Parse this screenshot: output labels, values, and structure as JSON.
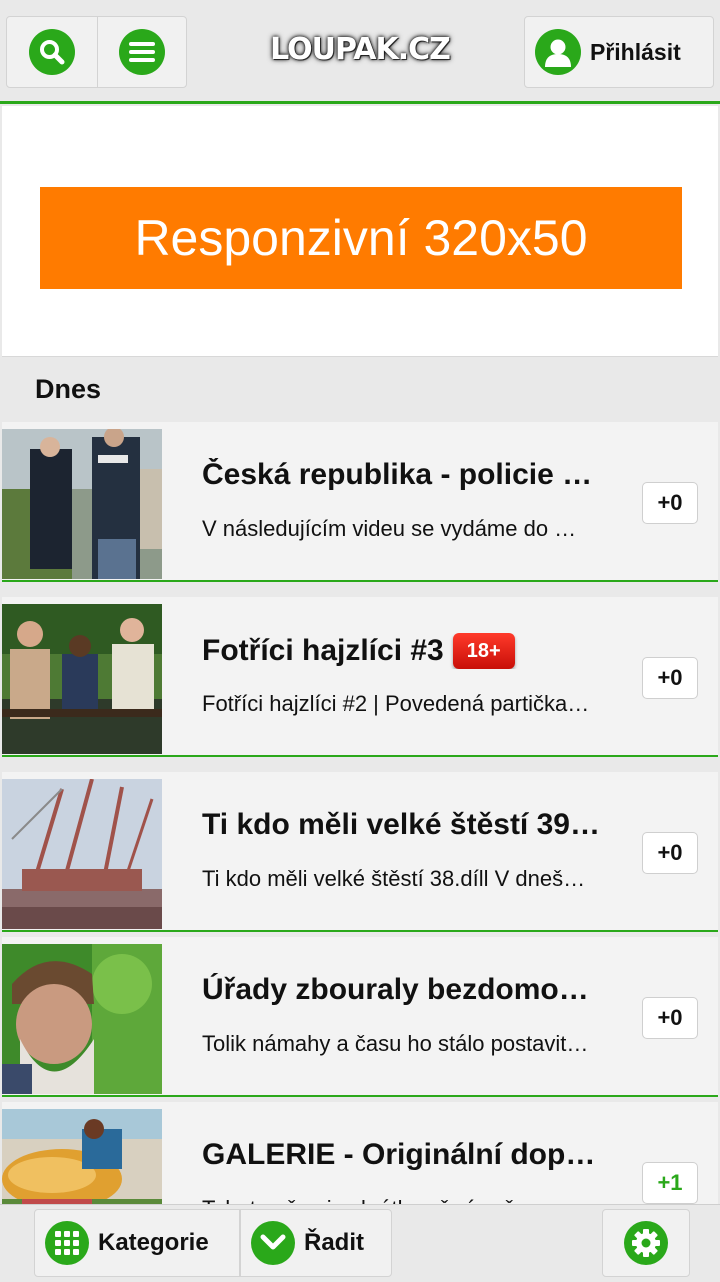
{
  "header": {
    "logo_text": "LOUPAK.CZ",
    "login_label": "Přihlásit"
  },
  "ad": {
    "label": "Responzivní 320x50"
  },
  "section": {
    "title": "Dnes"
  },
  "items": [
    {
      "title": "Česká republika - policie …",
      "description": "V následujícím videu se vydáme do …",
      "score": "+0",
      "badge": ""
    },
    {
      "title": "Fotříci hajzlíci #3",
      "description": "Fotříci hajzlíci #2 | Povedená partička…",
      "score": "+0",
      "badge": "18+"
    },
    {
      "title": "Ti kdo měli velké štěstí 39…",
      "description": "Ti kdo měli velké štěstí 38.díll V dneš…",
      "score": "+0",
      "badge": ""
    },
    {
      "title": "Úřady zbouraly bezdomo…",
      "description": "Tolik námahy a času ho stálo postavit…",
      "score": "+0",
      "badge": ""
    },
    {
      "title": "GALERIE - Originální dop…",
      "description": "Tohoto už asi zakrátko už vím, že…",
      "score": "+1",
      "badge": ""
    }
  ],
  "footer": {
    "categories_label": "Kategorie",
    "sort_label": "Řadit"
  },
  "colors": {
    "accent_green": "#2aa81a",
    "ad_orange": "#ff7b00",
    "badge_red": "#e21b12"
  },
  "icons": {
    "search": "search-icon",
    "menu": "menu-icon",
    "user": "user-icon",
    "grid": "grid-icon",
    "sort": "chevron-down-icon",
    "settings": "gear-icon"
  }
}
